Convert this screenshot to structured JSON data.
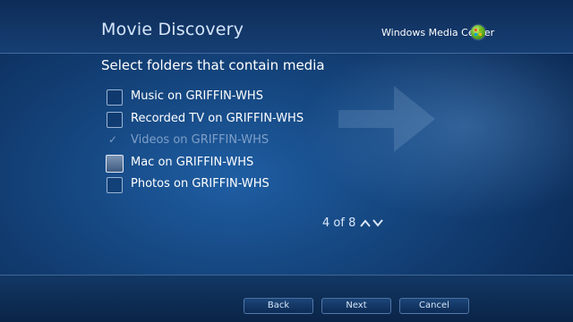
{
  "header": {
    "title": "Movie Discovery",
    "brand": "Windows Media Center"
  },
  "instruction": "Select folders that contain media",
  "folders": [
    {
      "label": "Music on GRIFFIN-WHS",
      "checked": false,
      "enabled": true,
      "focused": false
    },
    {
      "label": "Recorded TV on GRIFFIN-WHS",
      "checked": false,
      "enabled": true,
      "focused": false
    },
    {
      "label": "Videos on GRIFFIN-WHS",
      "checked": true,
      "enabled": false,
      "focused": false
    },
    {
      "label": "Mac on GRIFFIN-WHS",
      "checked": false,
      "enabled": true,
      "focused": true
    },
    {
      "label": "Photos on GRIFFIN-WHS",
      "checked": false,
      "enabled": true,
      "focused": false
    }
  ],
  "pager": {
    "text": "4 of 8"
  },
  "footer": {
    "back_label": "Back",
    "next_label": "Next",
    "cancel_label": "Cancel"
  },
  "colors": {
    "background": "#15467f",
    "text": "#ffffff",
    "disabled_text": "#7e9fc9",
    "title": "#d6e6fb"
  },
  "icons": {
    "logo": "windows-media-center-logo-icon",
    "background_arrow": "right-arrow-icon",
    "pager_up": "chevron-up-icon",
    "pager_down": "chevron-down-icon",
    "check": "checkmark-icon"
  }
}
